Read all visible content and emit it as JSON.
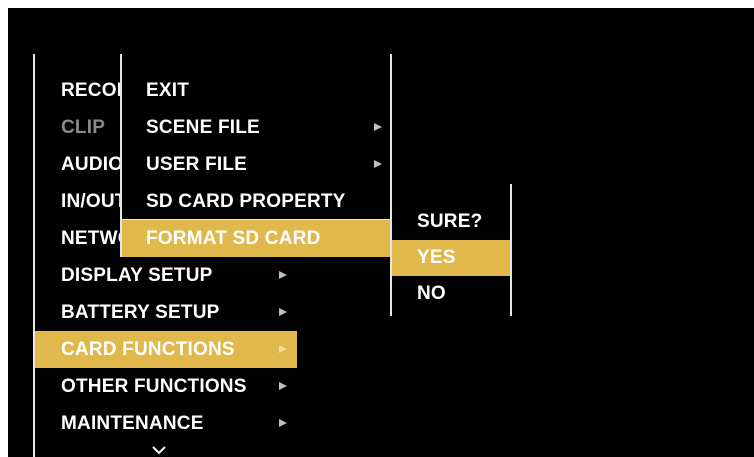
{
  "main_menu": {
    "items": [
      {
        "label": "RECORDING SETUP",
        "has_submenu": true
      },
      {
        "label": "CLIP",
        "has_submenu": true,
        "dimmed": true
      },
      {
        "label": "AUDIO",
        "has_submenu": true
      },
      {
        "label": "IN/OUT",
        "has_submenu": true
      },
      {
        "label": "NETWORK",
        "has_submenu": true
      },
      {
        "label": "DISPLAY SETUP",
        "has_submenu": true
      },
      {
        "label": "BATTERY SETUP",
        "has_submenu": true
      },
      {
        "label": "CARD FUNCTIONS",
        "has_submenu": true,
        "selected": true
      },
      {
        "label": "OTHER FUNCTIONS",
        "has_submenu": true
      },
      {
        "label": "MAINTENANCE",
        "has_submenu": true
      }
    ],
    "more_indicator_icon": "chevron-down-icon"
  },
  "card_functions_menu": {
    "items": [
      {
        "label": "EXIT",
        "has_submenu": false
      },
      {
        "label": "SCENE FILE",
        "has_submenu": true
      },
      {
        "label": "USER FILE",
        "has_submenu": true
      },
      {
        "label": "SD CARD PROPERTY",
        "has_submenu": false
      },
      {
        "label": "FORMAT SD CARD",
        "has_submenu": false,
        "selected": true
      }
    ]
  },
  "confirm_menu": {
    "title": "SURE?",
    "items": [
      {
        "label": "YES",
        "selected": true
      },
      {
        "label": "NO",
        "selected": false
      }
    ]
  },
  "colors": {
    "highlight": "#e0b84c",
    "background": "#000000",
    "text": "#ffffff",
    "dimmed_text": "#8a8a8a"
  }
}
